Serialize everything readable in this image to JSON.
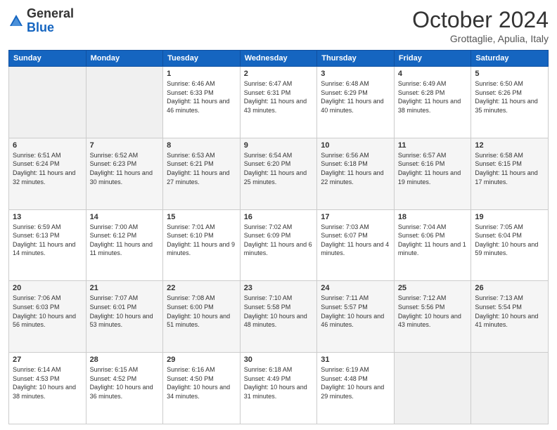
{
  "header": {
    "logo": {
      "line1": "General",
      "line2": "Blue"
    },
    "title": "October 2024",
    "location": "Grottaglie, Apulia, Italy"
  },
  "weekdays": [
    "Sunday",
    "Monday",
    "Tuesday",
    "Wednesday",
    "Thursday",
    "Friday",
    "Saturday"
  ],
  "weeks": [
    [
      {
        "day": null
      },
      {
        "day": null
      },
      {
        "day": "1",
        "sunrise": "6:46 AM",
        "sunset": "6:33 PM",
        "daylight": "11 hours and 46 minutes."
      },
      {
        "day": "2",
        "sunrise": "6:47 AM",
        "sunset": "6:31 PM",
        "daylight": "11 hours and 43 minutes."
      },
      {
        "day": "3",
        "sunrise": "6:48 AM",
        "sunset": "6:29 PM",
        "daylight": "11 hours and 40 minutes."
      },
      {
        "day": "4",
        "sunrise": "6:49 AM",
        "sunset": "6:28 PM",
        "daylight": "11 hours and 38 minutes."
      },
      {
        "day": "5",
        "sunrise": "6:50 AM",
        "sunset": "6:26 PM",
        "daylight": "11 hours and 35 minutes."
      }
    ],
    [
      {
        "day": "6",
        "sunrise": "6:51 AM",
        "sunset": "6:24 PM",
        "daylight": "11 hours and 32 minutes."
      },
      {
        "day": "7",
        "sunrise": "6:52 AM",
        "sunset": "6:23 PM",
        "daylight": "11 hours and 30 minutes."
      },
      {
        "day": "8",
        "sunrise": "6:53 AM",
        "sunset": "6:21 PM",
        "daylight": "11 hours and 27 minutes."
      },
      {
        "day": "9",
        "sunrise": "6:54 AM",
        "sunset": "6:20 PM",
        "daylight": "11 hours and 25 minutes."
      },
      {
        "day": "10",
        "sunrise": "6:56 AM",
        "sunset": "6:18 PM",
        "daylight": "11 hours and 22 minutes."
      },
      {
        "day": "11",
        "sunrise": "6:57 AM",
        "sunset": "6:16 PM",
        "daylight": "11 hours and 19 minutes."
      },
      {
        "day": "12",
        "sunrise": "6:58 AM",
        "sunset": "6:15 PM",
        "daylight": "11 hours and 17 minutes."
      }
    ],
    [
      {
        "day": "13",
        "sunrise": "6:59 AM",
        "sunset": "6:13 PM",
        "daylight": "11 hours and 14 minutes."
      },
      {
        "day": "14",
        "sunrise": "7:00 AM",
        "sunset": "6:12 PM",
        "daylight": "11 hours and 11 minutes."
      },
      {
        "day": "15",
        "sunrise": "7:01 AM",
        "sunset": "6:10 PM",
        "daylight": "11 hours and 9 minutes."
      },
      {
        "day": "16",
        "sunrise": "7:02 AM",
        "sunset": "6:09 PM",
        "daylight": "11 hours and 6 minutes."
      },
      {
        "day": "17",
        "sunrise": "7:03 AM",
        "sunset": "6:07 PM",
        "daylight": "11 hours and 4 minutes."
      },
      {
        "day": "18",
        "sunrise": "7:04 AM",
        "sunset": "6:06 PM",
        "daylight": "11 hours and 1 minute."
      },
      {
        "day": "19",
        "sunrise": "7:05 AM",
        "sunset": "6:04 PM",
        "daylight": "10 hours and 59 minutes."
      }
    ],
    [
      {
        "day": "20",
        "sunrise": "7:06 AM",
        "sunset": "6:03 PM",
        "daylight": "10 hours and 56 minutes."
      },
      {
        "day": "21",
        "sunrise": "7:07 AM",
        "sunset": "6:01 PM",
        "daylight": "10 hours and 53 minutes."
      },
      {
        "day": "22",
        "sunrise": "7:08 AM",
        "sunset": "6:00 PM",
        "daylight": "10 hours and 51 minutes."
      },
      {
        "day": "23",
        "sunrise": "7:10 AM",
        "sunset": "5:58 PM",
        "daylight": "10 hours and 48 minutes."
      },
      {
        "day": "24",
        "sunrise": "7:11 AM",
        "sunset": "5:57 PM",
        "daylight": "10 hours and 46 minutes."
      },
      {
        "day": "25",
        "sunrise": "7:12 AM",
        "sunset": "5:56 PM",
        "daylight": "10 hours and 43 minutes."
      },
      {
        "day": "26",
        "sunrise": "7:13 AM",
        "sunset": "5:54 PM",
        "daylight": "10 hours and 41 minutes."
      }
    ],
    [
      {
        "day": "27",
        "sunrise": "6:14 AM",
        "sunset": "4:53 PM",
        "daylight": "10 hours and 38 minutes."
      },
      {
        "day": "28",
        "sunrise": "6:15 AM",
        "sunset": "4:52 PM",
        "daylight": "10 hours and 36 minutes."
      },
      {
        "day": "29",
        "sunrise": "6:16 AM",
        "sunset": "4:50 PM",
        "daylight": "10 hours and 34 minutes."
      },
      {
        "day": "30",
        "sunrise": "6:18 AM",
        "sunset": "4:49 PM",
        "daylight": "10 hours and 31 minutes."
      },
      {
        "day": "31",
        "sunrise": "6:19 AM",
        "sunset": "4:48 PM",
        "daylight": "10 hours and 29 minutes."
      },
      {
        "day": null
      },
      {
        "day": null
      }
    ]
  ],
  "labels": {
    "sunrise": "Sunrise:",
    "sunset": "Sunset:",
    "daylight": "Daylight:"
  }
}
